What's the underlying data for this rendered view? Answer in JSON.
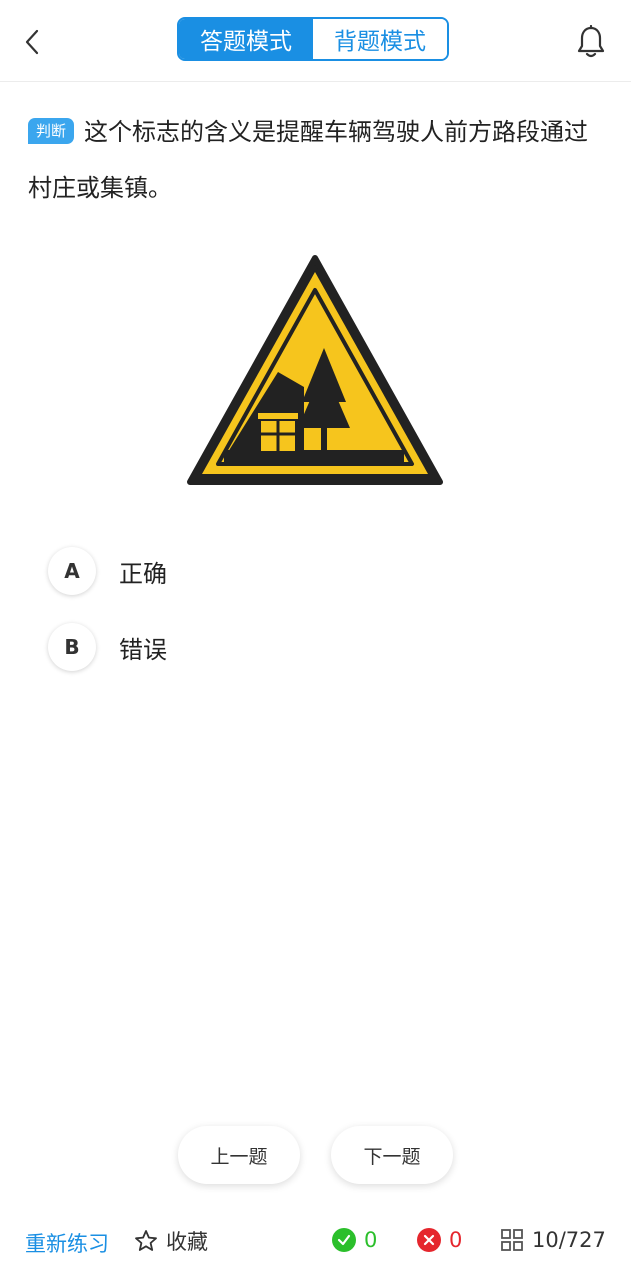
{
  "header": {
    "back_icon": "chevron-left-icon",
    "tabs": [
      {
        "label": "答题模式",
        "active": true
      },
      {
        "label": "背题模式",
        "active": false
      }
    ],
    "bell_icon": "bell-icon"
  },
  "question": {
    "type_tag": "判断",
    "text": "这个标志的含义是提醒车辆驾驶人前方路段通过村庄或集镇。",
    "image": "village-warning-sign"
  },
  "options": [
    {
      "letter": "A",
      "text": "正确"
    },
    {
      "letter": "B",
      "text": "错误"
    }
  ],
  "nav": {
    "prev_label": "上一题",
    "next_label": "下一题"
  },
  "footer": {
    "retry_label": "重新练习",
    "favorite_label": "收藏",
    "correct_count": "0",
    "wrong_count": "0",
    "progress": "10/727"
  },
  "colors": {
    "accent": "#1a8fe3",
    "correct": "#2bbf2b",
    "wrong": "#e5262d",
    "sign_yellow": "#f6c51d"
  }
}
